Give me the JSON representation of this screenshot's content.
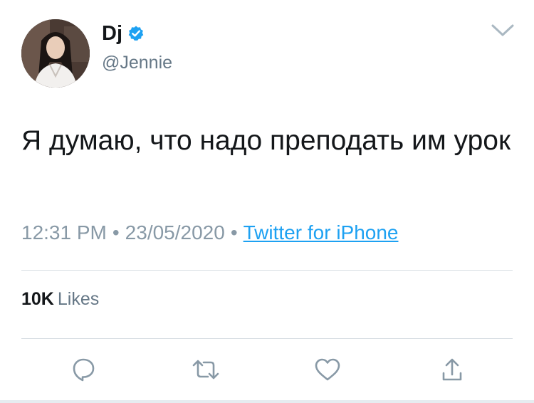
{
  "user": {
    "display_name": "Dj",
    "handle": "@Jennie",
    "verified": true
  },
  "tweet": {
    "text": "Я думаю, что надо преподать им урок",
    "time": "12:31 PM",
    "date": "23/05/2020",
    "separator": "•",
    "source": "Twitter for iPhone"
  },
  "stats": {
    "likes_count": "10K",
    "likes_label": "Likes"
  },
  "actions": {
    "reply_icon": "reply-icon",
    "retweet_icon": "retweet-icon",
    "like_icon": "heart-icon",
    "share_icon": "share-icon"
  },
  "colors": {
    "text": "#14171a",
    "secondary": "#657786",
    "meta": "#8899a6",
    "link": "#1da1f2",
    "verified": "#1da1f2",
    "divider": "#d6dde3",
    "icon": "#8899a6"
  }
}
